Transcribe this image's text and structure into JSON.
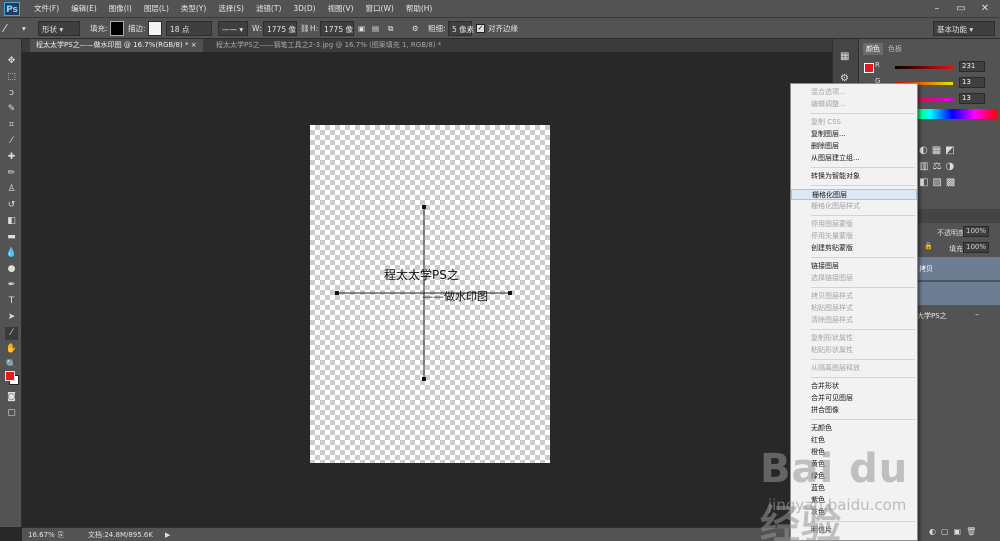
{
  "app": {
    "logo": "Ps"
  },
  "menubar": {
    "items": [
      "文件(F)",
      "编辑(E)",
      "图像(I)",
      "图层(L)",
      "类型(Y)",
      "选择(S)",
      "滤镜(T)",
      "3D(D)",
      "视图(V)",
      "窗口(W)",
      "帮助(H)"
    ]
  },
  "options": {
    "mode": "形状",
    "fill_label": "填充:",
    "stroke_label": "描边:",
    "stroke_size": "18 点",
    "w_label": "W:",
    "w_value": "1775 像",
    "h_label": "H:",
    "h_value": "1775 像",
    "weight_label": "粗细:",
    "weight_value": "5 像素",
    "align_label": "对齐边缘",
    "workspace": "基本功能"
  },
  "tabs": {
    "active": "程太太学PS之——做水印图 @ 16.7%(RGB/8) *",
    "inactive": "程太太学PS之——钢笔工具之2-3.jpg @ 16.7% (图案填充 1, RGB/8) *"
  },
  "canvas": {
    "text_line1": "程太太学PS之",
    "text_line2": "——做水印图"
  },
  "status": {
    "zoom": "16.67%",
    "doc": "文档:24.8M/895.6K"
  },
  "color_panel": {
    "tab_color": "颜色",
    "tab_swatches": "色板",
    "r_label": "R",
    "g_label": "G",
    "b_label": "B",
    "r_value": "231",
    "g_value": "13",
    "b_value": "13",
    "foreground": "#e5171f"
  },
  "layers_panel": {
    "opacity_label": "不透明度:",
    "opacity_value": "100%",
    "fill_label": "填充:",
    "fill_value": "100%",
    "layer_copy": "拷贝",
    "layer_text": "大学PS之"
  },
  "context_menu": {
    "items": [
      {
        "label": "混合选项...",
        "disabled": true
      },
      {
        "label": "编辑调整...",
        "disabled": true
      },
      {
        "label": "复制 CSS",
        "disabled": true
      },
      {
        "label": "复制图层...",
        "disabled": false
      },
      {
        "label": "删除图层",
        "disabled": false
      },
      {
        "label": "从图层建立组...",
        "disabled": false
      },
      {
        "label": "转换为智能对象",
        "disabled": false
      },
      {
        "label": "栅格化图层",
        "disabled": false
      },
      {
        "label": "栅格化图层样式",
        "disabled": true
      },
      {
        "label": "停用图层蒙版",
        "disabled": true
      },
      {
        "label": "停用矢量蒙版",
        "disabled": true
      },
      {
        "label": "创建剪贴蒙版",
        "disabled": false
      },
      {
        "label": "链接图层",
        "disabled": false
      },
      {
        "label": "选择链接图层",
        "disabled": true
      },
      {
        "label": "拷贝图层样式",
        "disabled": true
      },
      {
        "label": "粘贴图层样式",
        "disabled": true
      },
      {
        "label": "清除图层样式",
        "disabled": true
      },
      {
        "label": "复制形状属性",
        "disabled": true
      },
      {
        "label": "粘贴形状属性",
        "disabled": true
      },
      {
        "label": "从隔离图层释放",
        "disabled": true
      },
      {
        "label": "合并形状",
        "disabled": false
      },
      {
        "label": "合并可见图层",
        "disabled": false
      },
      {
        "label": "拼合图像",
        "disabled": false
      },
      {
        "label": "无颜色",
        "disabled": false
      },
      {
        "label": "红色",
        "disabled": false
      },
      {
        "label": "橙色",
        "disabled": false
      },
      {
        "label": "黄色",
        "disabled": false
      },
      {
        "label": "绿色",
        "disabled": false
      },
      {
        "label": "蓝色",
        "disabled": false
      },
      {
        "label": "紫色",
        "disabled": false
      },
      {
        "label": "灰色",
        "disabled": false
      },
      {
        "label": "明信片",
        "disabled": false
      }
    ],
    "highlighted_index": 7
  },
  "watermark": {
    "brand": "Bai du 经验",
    "url": "jingyan.baidu.com"
  },
  "colors": {
    "ui_panel": "#535353",
    "workspace": "#282828",
    "menu_bg": "#f2f2f2",
    "highlight": "#dde8f5",
    "layer_selected": "#6d7e93"
  }
}
